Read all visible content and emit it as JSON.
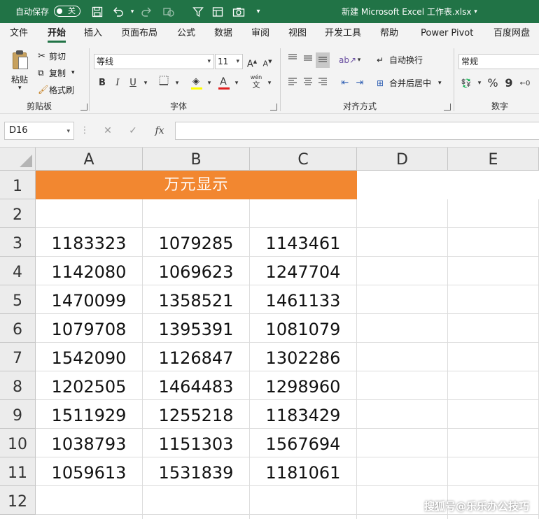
{
  "titlebar": {
    "autosave_label": "自动保存",
    "autosave_state": "关",
    "doc_title": "新建 Microsoft Excel 工作表.xlsx",
    "qa_icons": [
      "save-icon",
      "undo-icon",
      "redo-icon",
      "shape-icon",
      "filter-icon",
      "form-icon",
      "camera-icon",
      "customize-icon"
    ]
  },
  "tabs": [
    "文件",
    "开始",
    "插入",
    "页面布局",
    "公式",
    "数据",
    "审阅",
    "视图",
    "开发工具",
    "帮助",
    "Power Pivot",
    "百度网盘"
  ],
  "active_tab": "开始",
  "ribbon": {
    "clipboard": {
      "paste": "粘贴",
      "cut": "剪切",
      "copy": "复制",
      "format_painter": "格式刷",
      "label": "剪贴板"
    },
    "font": {
      "font_name": "等线",
      "font_size": "11",
      "bold": "B",
      "italic": "I",
      "underline": "U",
      "phonetic": "wén",
      "phonetic_char": "文",
      "increase": "A",
      "decrease": "A",
      "label": "字体"
    },
    "alignment": {
      "wrap_text": "自动换行",
      "merge_center": "合并后居中",
      "label": "对齐方式"
    },
    "number": {
      "format": "常规",
      "percent": "%",
      "comma": "9",
      "label": "数字"
    }
  },
  "formula_bar": {
    "name_box": "D16",
    "fx": "fx",
    "formula": ""
  },
  "columns": [
    "A",
    "B",
    "C",
    "D",
    "E"
  ],
  "rows": [
    "1",
    "2",
    "3",
    "4",
    "5",
    "6",
    "7",
    "8",
    "9",
    "10",
    "11",
    "12"
  ],
  "header_cell": "万元显示",
  "table": [
    [
      "1183323",
      "1079285",
      "1143461"
    ],
    [
      "1142080",
      "1069623",
      "1247704"
    ],
    [
      "1470099",
      "1358521",
      "1461133"
    ],
    [
      "1079708",
      "1395391",
      "1081079"
    ],
    [
      "1542090",
      "1126847",
      "1302286"
    ],
    [
      "1202505",
      "1464483",
      "1298960"
    ],
    [
      "1511929",
      "1255218",
      "1183429"
    ],
    [
      "1038793",
      "1151303",
      "1567694"
    ],
    [
      "1059613",
      "1531839",
      "1181061"
    ]
  ],
  "colors": {
    "header_fill": "#F28730",
    "accent": "#217346"
  },
  "watermark": "搜狐号@乐乐办公技巧"
}
